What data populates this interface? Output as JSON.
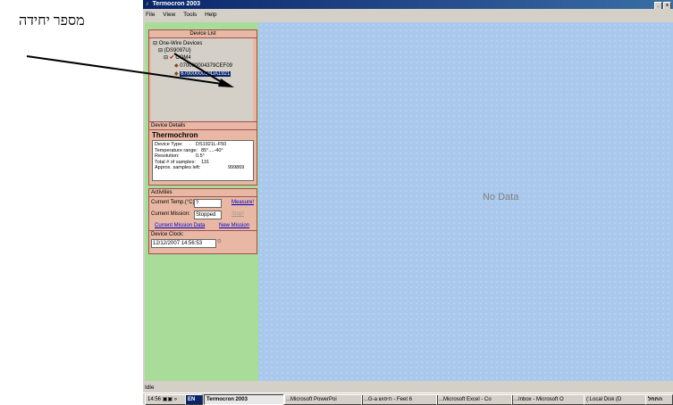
{
  "annotation": "מספר יחידה",
  "window": {
    "title": "Termocron 2003",
    "controls": [
      "_",
      "x"
    ]
  },
  "menu": [
    "File",
    "View",
    "Tools",
    "Help"
  ],
  "device_list": {
    "header": "Device List",
    "root": "One-Wire Devices",
    "adapter": "{DS9097U}",
    "port": "COM4",
    "devices": [
      "070000004379CEF09",
      "6700000019DA1921"
    ]
  },
  "device_details": {
    "header": "Device Details",
    "name": "Thermochron",
    "rows": [
      {
        "label": "Device Type:",
        "value": "DS1921L-F50"
      },
      {
        "label": "Temperature range:",
        "value": "85°....-40°"
      },
      {
        "label": "Resolution:",
        "value": "0.5°"
      },
      {
        "label": "Total # of samples:",
        "value": "131"
      },
      {
        "label": "Approx. samples left:",
        "value": "999869"
      }
    ]
  },
  "activities": {
    "header": "Activities",
    "current_temp_label": "Current Temp.(°C):",
    "current_temp_value": "?",
    "measure": "Measure!",
    "current_mission_label": "Current Mission:",
    "current_mission_value": "Stopped",
    "stop": "Stop!",
    "current_mission_data": "Current Mission Data",
    "new_mission": "New Mission",
    "device_clock_label": "Device Clock:",
    "device_clock_value": "12/12/2007 14:56:53"
  },
  "main": {
    "no_data": "No Data"
  },
  "status": "Idle",
  "taskbar": {
    "time": "14:56",
    "tray": "»",
    "lang": "EN",
    "items": [
      "Termocron 2003",
      "...Microsoft PowerPoi",
      "...G-a חיפוש - Feet 6",
      "...Microsoft Excel - Co",
      "...Inbox - Microsoft O",
      "(:Local Disk (D",
      "התחל"
    ]
  }
}
